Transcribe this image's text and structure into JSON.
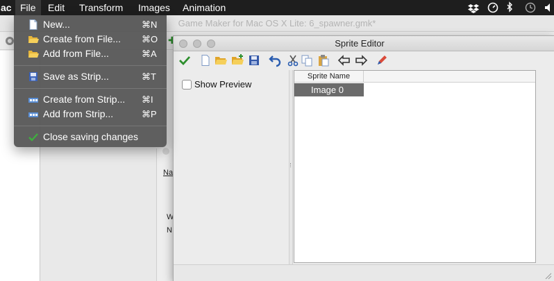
{
  "menubar": {
    "app_fragment": "ac",
    "menus": [
      "File",
      "Edit",
      "Transform",
      "Images",
      "Animation"
    ],
    "status_icons": [
      "dropbox-icon",
      "timemachine-icon",
      "bluetooth-icon",
      "history-icon",
      "volume-icon"
    ]
  },
  "gm_window": {
    "title": "Game Maker for Mac OS X Lite: 6_spawner.gmk*",
    "object_labels": [
      "Na",
      "W",
      "N"
    ]
  },
  "file_menu": {
    "items": [
      {
        "label": "New...",
        "shortcut": "⌘N",
        "icon": "new-file-icon"
      },
      {
        "label": "Create from File...",
        "shortcut": "⌘O",
        "icon": "folder-open-icon"
      },
      {
        "label": "Add from File...",
        "shortcut": "⌘A",
        "icon": "folder-add-icon"
      },
      {
        "label": "Save as Strip...",
        "shortcut": "⌘T",
        "icon": "save-strip-icon"
      },
      {
        "label": "Create from Strip...",
        "shortcut": "⌘I",
        "icon": "strip-create-icon"
      },
      {
        "label": "Add from Strip...",
        "shortcut": "⌘P",
        "icon": "strip-add-icon"
      },
      {
        "label": "Close saving changes",
        "shortcut": "",
        "icon": "checkmark-icon"
      }
    ]
  },
  "sprite_editor": {
    "title": "Sprite Editor",
    "show_preview_label": "Show Preview",
    "show_preview_checked": false,
    "column_header": "Sprite Name",
    "rows": [
      "Image 0"
    ],
    "toolbar_icons": [
      "confirm-checkmark-icon",
      "new-image-icon",
      "open-folder-icon",
      "add-folder-icon",
      "save-disk-icon",
      "undo-icon",
      "cut-icon",
      "copy-icon",
      "paste-icon",
      "shift-left-icon",
      "shift-right-icon",
      "edit-pencil-icon"
    ]
  },
  "colors": {
    "menubar_bg": "#1e1e1e",
    "menu_bg": "#585858",
    "selection_row": "#6b6b6b",
    "accent_green": "#2d8f2d",
    "accent_blue": "#2a5db0"
  }
}
